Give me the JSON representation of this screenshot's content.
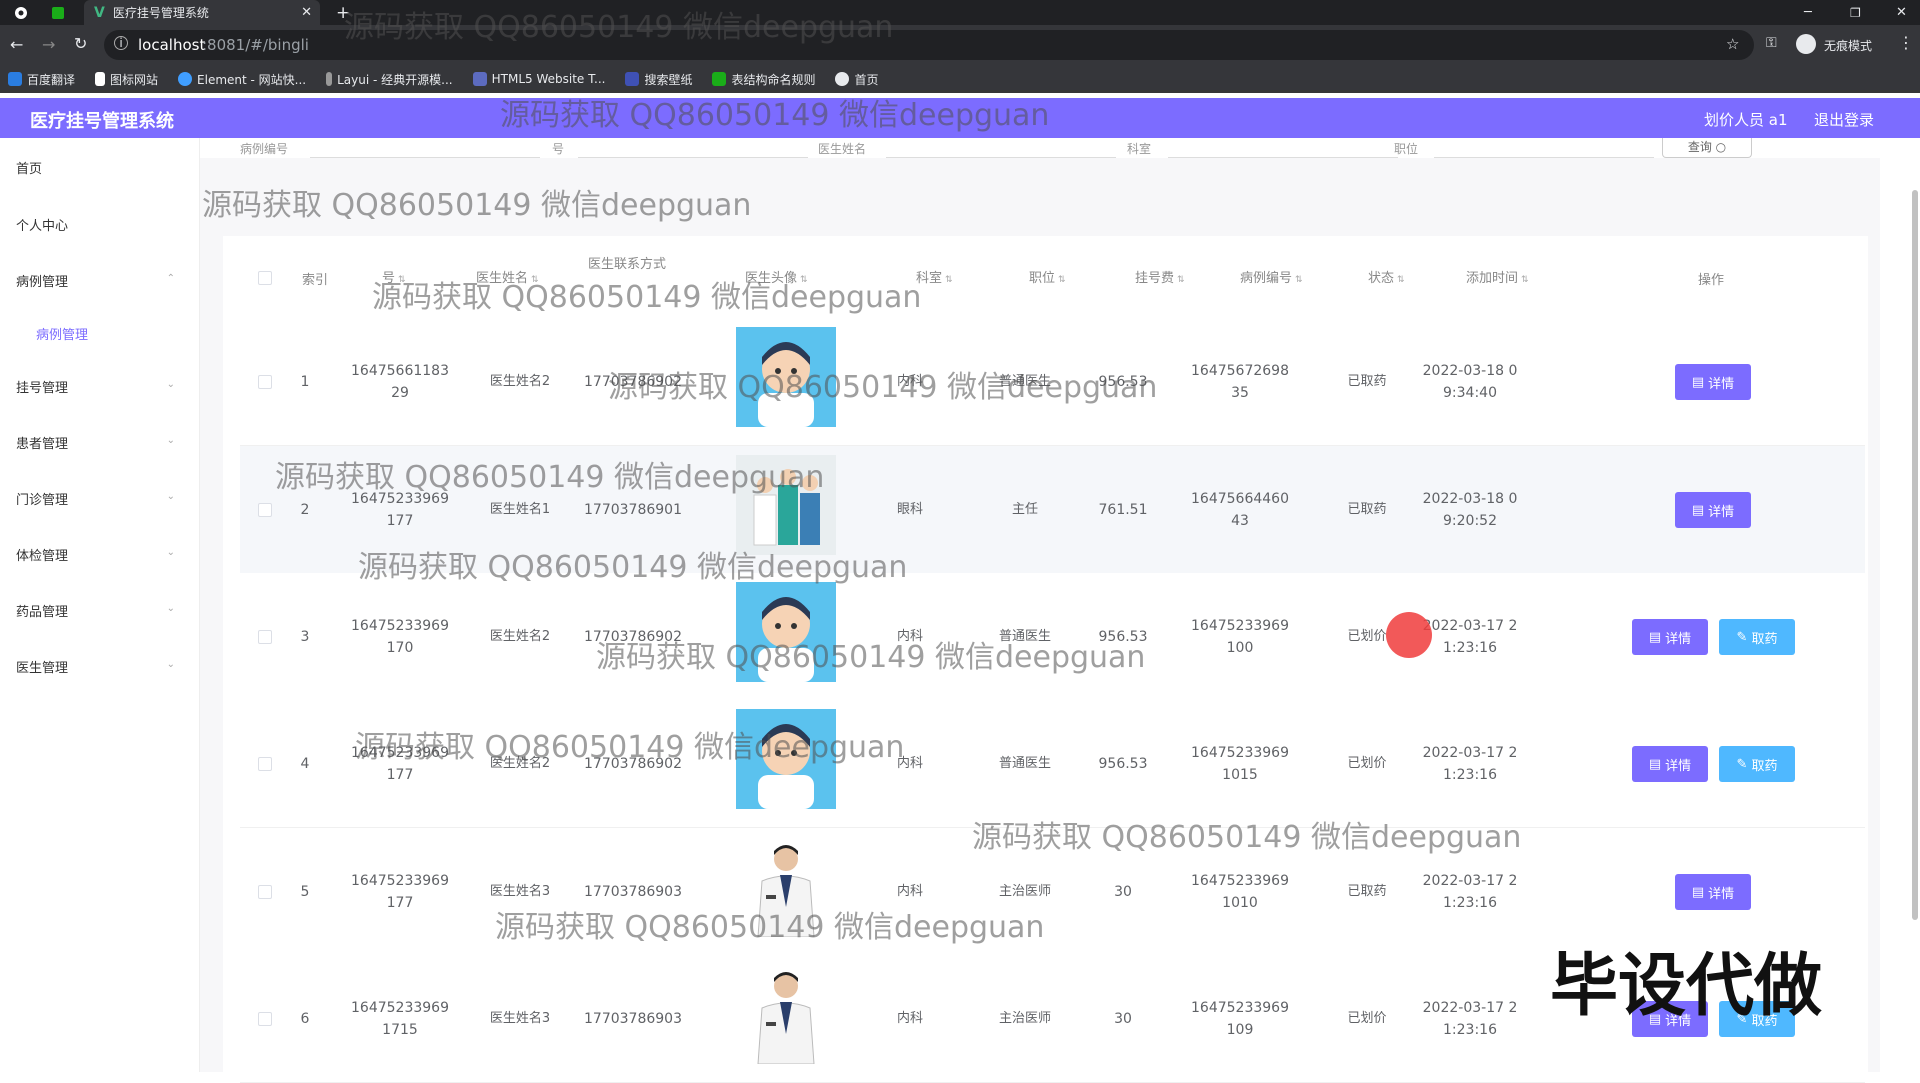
{
  "browser": {
    "tab_title": "医疗挂号管理系统",
    "new_tab": "+",
    "url_host": "localhost",
    "url_rest": ":8081/#/bingli",
    "profile_label": "无痕模式",
    "bookmarks": [
      "百度翻译",
      "图标网站",
      "Element - 网站快...",
      "Layui - 经典开源模...",
      "HTML5 Website T...",
      "搜索壁纸",
      "表结构命名规则",
      "首页"
    ]
  },
  "header": {
    "title": "医疗挂号管理系统",
    "user": "划价人员 a1",
    "logout": "退出登录"
  },
  "sidebar": {
    "items": [
      {
        "label": "首页"
      },
      {
        "label": "个人中心"
      },
      {
        "label": "病例管理"
      },
      {
        "label": "病例管理"
      },
      {
        "label": "挂号管理"
      },
      {
        "label": "患者管理"
      },
      {
        "label": "门诊管理"
      },
      {
        "label": "体检管理"
      },
      {
        "label": "药品管理"
      },
      {
        "label": "医生管理"
      }
    ]
  },
  "search": {
    "labels": [
      "病例编号",
      "号",
      "医生姓名",
      "科室",
      "职位"
    ],
    "query_btn": "查询"
  },
  "table": {
    "headers": [
      "索引",
      "号",
      "医生姓名",
      "医生联系方式",
      "医生头像",
      "科室",
      "职位",
      "挂号费",
      "病例编号",
      "状态",
      "添加时间",
      "操作"
    ],
    "detail_label": "详情",
    "cancel_label": "取药",
    "rows": [
      {
        "idx": "1",
        "no1": "16475661183",
        "no2": "29",
        "doctor": "医生姓名2",
        "phone": "17703786902",
        "dept": "内科",
        "pos": "普通医生",
        "fee": "956.53",
        "case1": "16475672698",
        "case2": "35",
        "status": "已取药",
        "t1": "2022-03-18 0",
        "t2": "9:34:40",
        "cancel": false,
        "avatar": "cartoon"
      },
      {
        "idx": "2",
        "no1": "16475233969",
        "no2": "177",
        "doctor": "医生姓名1",
        "phone": "17703786901",
        "dept": "眼科",
        "pos": "主任",
        "fee": "761.51",
        "case1": "16475664460",
        "case2": "43",
        "status": "已取药",
        "t1": "2022-03-18 0",
        "t2": "9:20:52",
        "cancel": false,
        "avatar": "group"
      },
      {
        "idx": "3",
        "no1": "16475233969",
        "no2": "170",
        "doctor": "医生姓名2",
        "phone": "17703786902",
        "dept": "内科",
        "pos": "普通医生",
        "fee": "956.53",
        "case1": "16475233969",
        "case2": "100",
        "status": "已划价",
        "t1": "2022-03-17 2",
        "t2": "1:23:16",
        "cancel": true,
        "avatar": "cartoon"
      },
      {
        "idx": "4",
        "no1": "16475233969",
        "no2": "177",
        "doctor": "医生姓名2",
        "phone": "17703786902",
        "dept": "内科",
        "pos": "普通医生",
        "fee": "956.53",
        "case1": "16475233969",
        "case2": "1015",
        "status": "已划价",
        "t1": "2022-03-17 2",
        "t2": "1:23:16",
        "cancel": true,
        "avatar": "cartoon"
      },
      {
        "idx": "5",
        "no1": "16475233969",
        "no2": "177",
        "doctor": "医生姓名3",
        "phone": "17703786903",
        "dept": "内科",
        "pos": "主治医师",
        "fee": "30",
        "case1": "16475233969",
        "case2": "1010",
        "status": "已取药",
        "t1": "2022-03-17 2",
        "t2": "1:23:16",
        "cancel": false,
        "avatar": "photo"
      },
      {
        "idx": "6",
        "no1": "16475233969",
        "no2": "1715",
        "doctor": "医生姓名3",
        "phone": "17703786903",
        "dept": "内科",
        "pos": "主治医师",
        "fee": "30",
        "case1": "16475233969",
        "case2": "109",
        "status": "已划价",
        "t1": "2022-03-17 2",
        "t2": "1:23:16",
        "cancel": true,
        "avatar": "photo"
      }
    ]
  },
  "watermarks": {
    "text": "源码获取 QQ86050149 微信deepguan",
    "big": "毕设代做"
  },
  "colors": {
    "primary": "#7c6cff",
    "cancel": "#4fb8ff",
    "chrome": "#35363a"
  }
}
